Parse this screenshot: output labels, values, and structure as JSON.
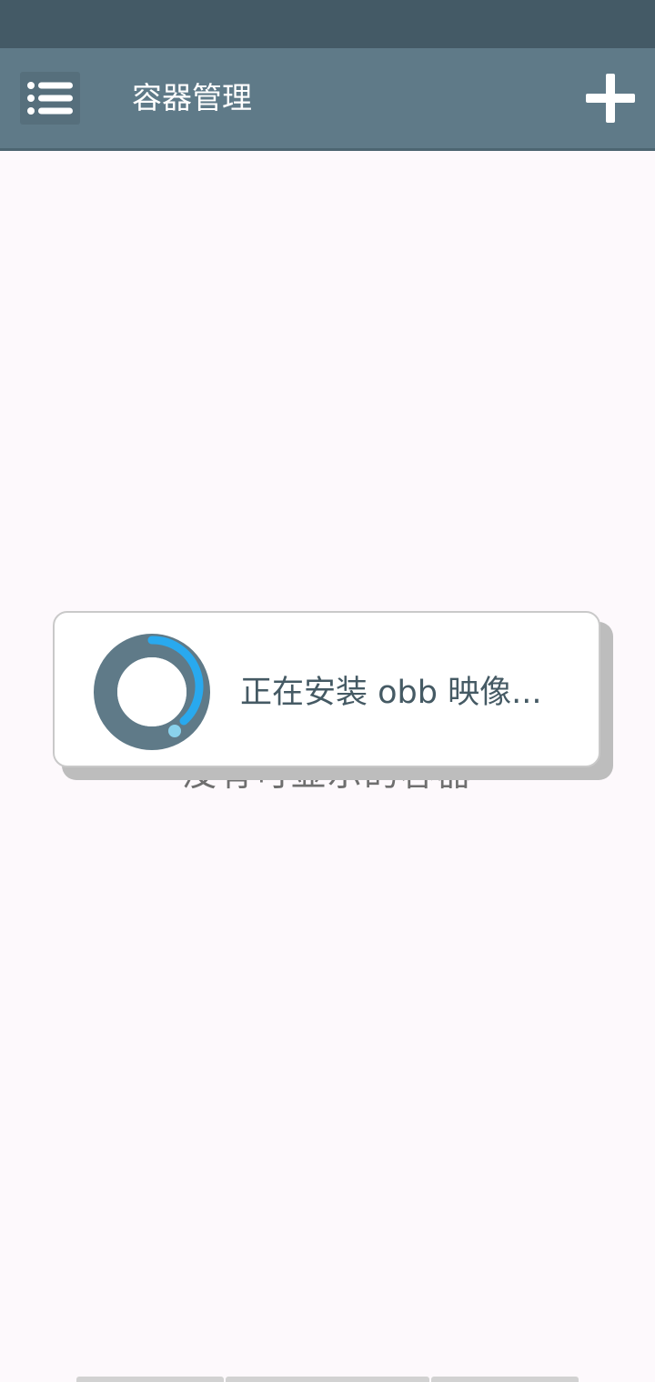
{
  "app_bar": {
    "title": "容器管理",
    "menu_icon": "list-menu-icon",
    "add_icon": "plus-icon"
  },
  "main": {
    "empty_message": "没有可显示的容器"
  },
  "dialog": {
    "message": "正在安装 obb 映像...",
    "spinner_icon": "loading-spinner-icon"
  },
  "colors": {
    "status_bar": "#445a66",
    "app_bar": "#5f7a88",
    "background": "#fdf9fc",
    "spinner_track": "#5f7a88",
    "spinner_arc": "#29a9ee",
    "dialog_text": "#455a64"
  }
}
